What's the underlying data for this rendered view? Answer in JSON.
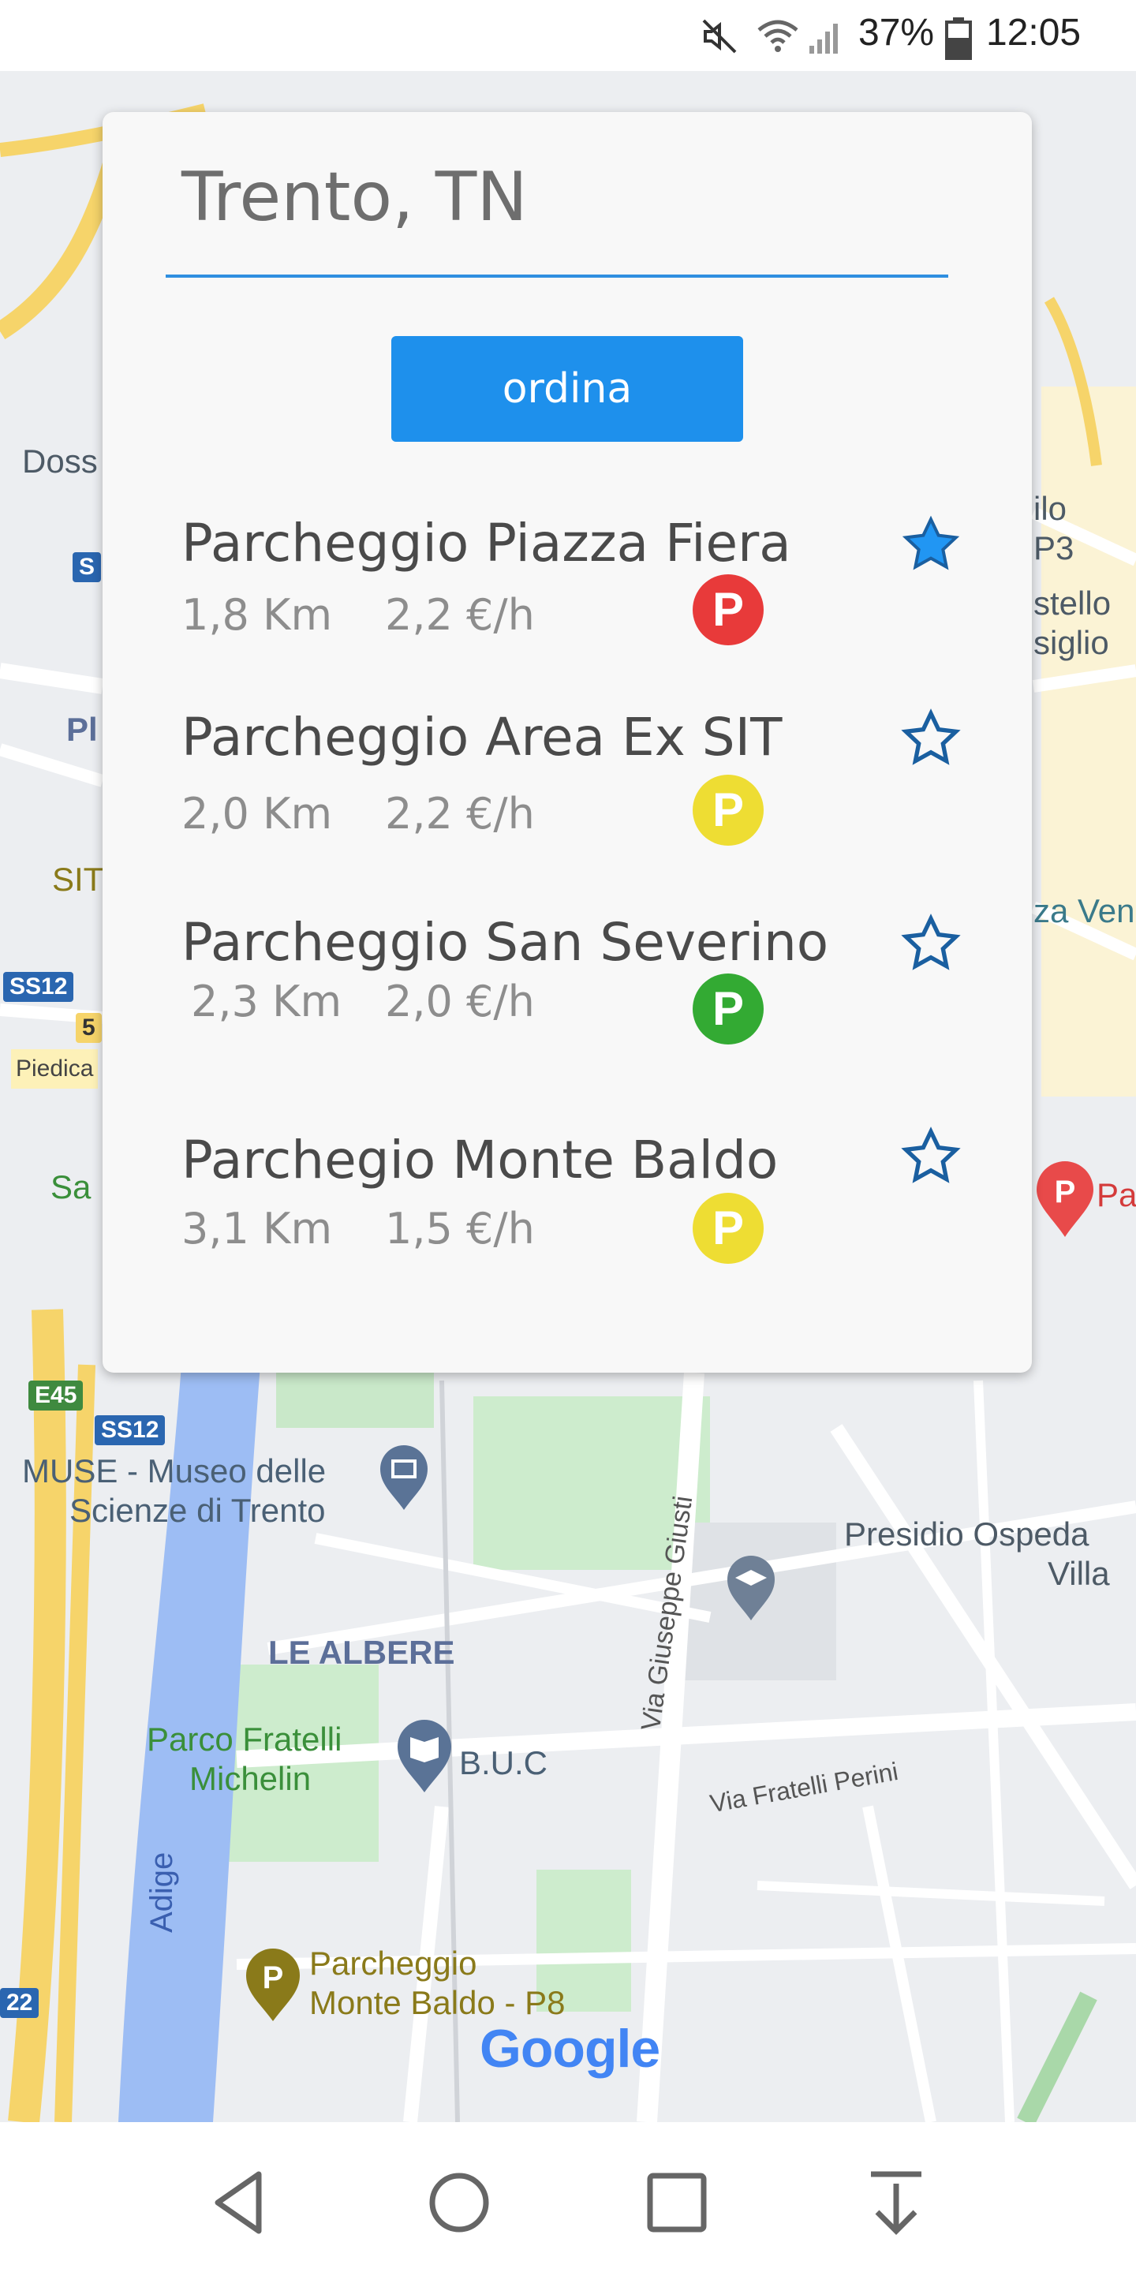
{
  "status_bar": {
    "battery": "37%",
    "time": "12:05",
    "icons": [
      "mute-icon",
      "wifi-icon",
      "signal-icon",
      "battery-icon"
    ]
  },
  "search": {
    "value": "Trento, TN"
  },
  "sort_button": {
    "label": "ordina"
  },
  "parkings": [
    {
      "name": "Parcheggio Piazza Fiera",
      "distance": "1,8 Km",
      "price": "2,2 €/h",
      "badge": "P",
      "badge_color": "#e83a3a",
      "favorite": true
    },
    {
      "name": "Parcheggio Area Ex SIT",
      "distance": "2,0 Km",
      "price": "2,2 €/h",
      "badge": "P",
      "badge_color": "#eedd33",
      "favorite": false
    },
    {
      "name": "Parcheggio San Severino",
      "distance": "2,3 Km",
      "price": "2,0 €/h",
      "badge": "P",
      "badge_color": "#33aa33",
      "favorite": false
    },
    {
      "name": "Parchegio Monte Baldo",
      "distance": "3,1 Km",
      "price": "1,5 €/h",
      "badge": "P",
      "badge_color": "#eedd33",
      "favorite": false
    }
  ],
  "map": {
    "labels": {
      "muse": "MUSE - Museo delle",
      "muse2": "Scienze di Trento",
      "le_albere": "LE ALBERE",
      "parco": "Parco Fratelli",
      "parco2": "Michelin",
      "buc": "B.U.C",
      "presidio": "Presidio Ospeda",
      "villa": "Villa",
      "adige": "Adige",
      "giusti": "Via Giuseppe Giusti",
      "perini": "Via Fratelli Perini",
      "parcheggio_mb": "Parcheggio",
      "parcheggio_mb2": "Monte Baldo - P8",
      "doss": "Doss",
      "piedica": "Piedica",
      "pi": "Pl",
      "sit": "SIT",
      "san": "Sa",
      "ilo": "ilo",
      "p3": "P3",
      "stello": "stello",
      "siglio": "siglio",
      "zaven": "za Ven",
      "pa": "Pa"
    },
    "shields": {
      "ss12_a": "SS12",
      "ss12_b": "SS12",
      "e45": "E45",
      "s": "S",
      "five": "5",
      "twentytwo": "22"
    },
    "google": "Google"
  },
  "nav": {
    "icons": [
      "back-icon",
      "home-icon",
      "recents-icon",
      "dropdown-icon"
    ]
  },
  "colors": {
    "accent": "#1e90ec",
    "star": "#1a5fa0"
  }
}
